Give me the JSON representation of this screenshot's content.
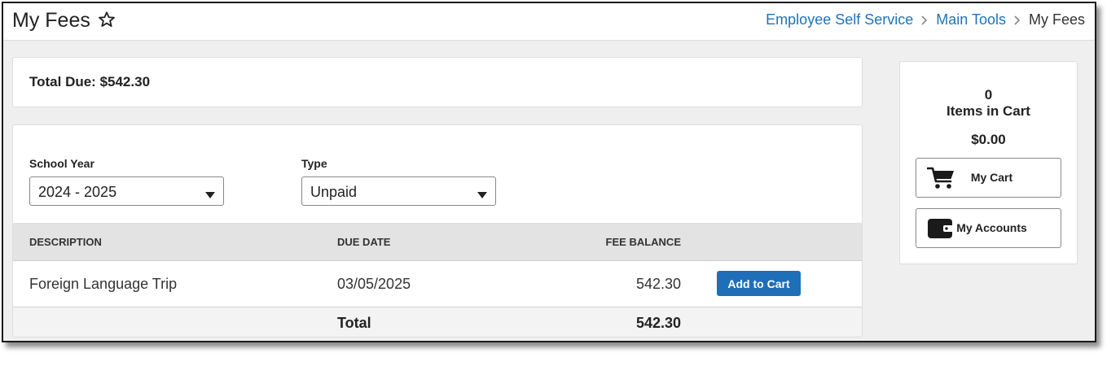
{
  "header": {
    "title": "My Fees",
    "favorite_icon": "star-outline-icon",
    "breadcrumb": [
      {
        "label": "Employee Self Service",
        "link": true
      },
      {
        "label": "Main Tools",
        "link": true
      },
      {
        "label": "My Fees",
        "link": false
      }
    ]
  },
  "summary": {
    "total_due_label": "Total Due: $542.30"
  },
  "filters": {
    "school_year": {
      "label": "School Year",
      "value": "2024 - 2025"
    },
    "type": {
      "label": "Type",
      "value": "Unpaid"
    }
  },
  "table": {
    "columns": [
      "DESCRIPTION",
      "DUE DATE",
      "FEE BALANCE"
    ],
    "rows": [
      {
        "description": "Foreign Language Trip",
        "due_date": "03/05/2025",
        "fee_balance": "542.30",
        "action_label": "Add to Cart"
      }
    ],
    "footer": {
      "label": "Total",
      "value": "542.30"
    }
  },
  "cart": {
    "count": "0",
    "items_label": "Items in Cart",
    "total": "$0.00",
    "my_cart_label": "My Cart",
    "my_cart_icon": "shopping-cart-icon",
    "my_accounts_label": "My Accounts",
    "my_accounts_icon": "wallet-icon"
  },
  "colors": {
    "link": "#1e72b8",
    "primary_button": "#1f6fb8",
    "page_background": "#efefef"
  }
}
